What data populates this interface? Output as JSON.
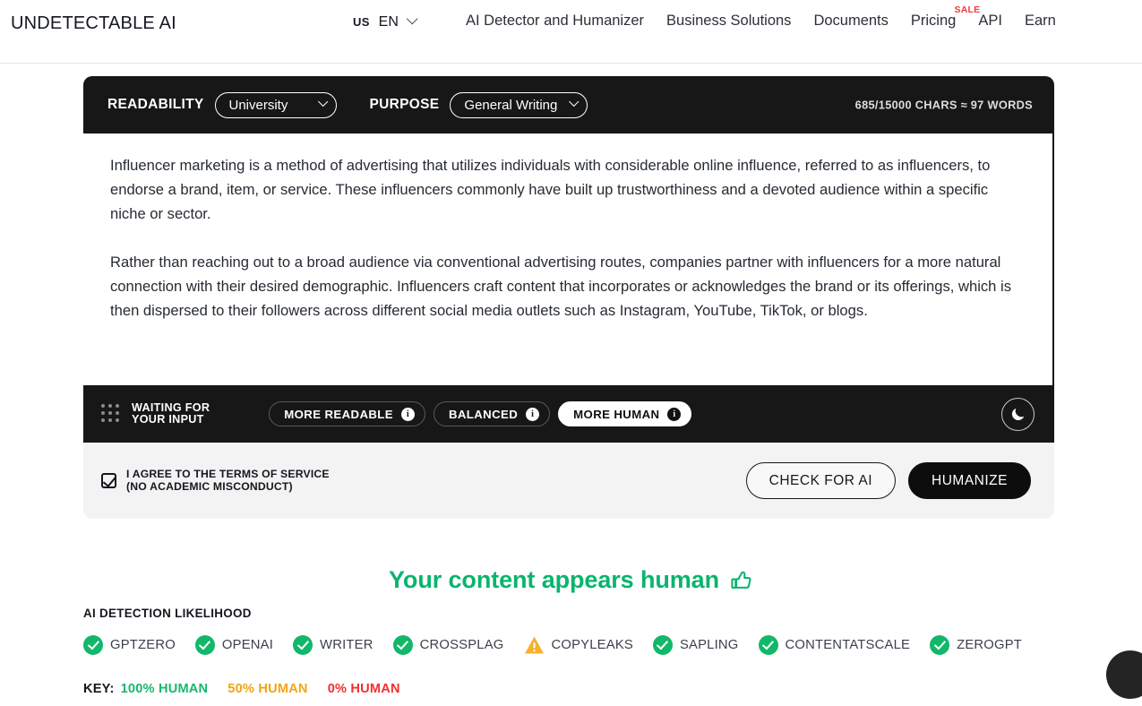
{
  "nav": {
    "brand": "UNDETECTABLE AI",
    "locale_country": "US",
    "locale_lang": "EN",
    "locale_chevron_icon": "chevron-down-icon",
    "links": [
      {
        "label": "AI Detector and Humanizer",
        "badge": ""
      },
      {
        "label": "Business Solutions",
        "badge": ""
      },
      {
        "label": "Documents",
        "badge": ""
      },
      {
        "label": "Pricing",
        "badge": "SALE"
      },
      {
        "label": "API",
        "badge": ""
      },
      {
        "label": "Earn",
        "badge": ""
      }
    ]
  },
  "editor": {
    "readability_label": "READABILITY",
    "readability_value": "University",
    "purpose_label": "PURPOSE",
    "purpose_value": "General Writing",
    "char_count": "685/15000 CHARS ≈ 97 WORDS",
    "paragraphs": [
      "Influencer marketing is a method of advertising that utilizes individuals with considerable online influence, referred to as influencers, to endorse a brand, item, or service. These influencers commonly have built up trustworthiness and a devoted audience within a specific niche or sector.",
      "Rather than reaching out to a broad audience via conventional advertising routes, companies partner with influencers for a more natural connection with their desired demographic. Influencers craft content that incorporates or acknowledges the brand or its offerings, which is then dispersed to their followers across different social media outlets such as Instagram, YouTube, TikTok, or blogs."
    ],
    "status": "WAITING FOR\nYOUR INPUT",
    "drag_icon": "dot-grid-icon",
    "modes": [
      {
        "label": "MORE READABLE",
        "active": false,
        "info_icon": "info-icon"
      },
      {
        "label": "BALANCED",
        "active": false,
        "info_icon": "info-icon"
      },
      {
        "label": "MORE HUMAN",
        "active": true,
        "info_icon": "info-icon"
      }
    ],
    "theme_toggle_icon": "moon-icon"
  },
  "footer": {
    "agree_text": "I AGREE TO THE TERMS OF SERVICE\n(NO ACADEMIC MISCONDUCT)",
    "agree_checked": true,
    "check_button": "CHECK FOR AI",
    "humanize_button": "HUMANIZE"
  },
  "results": {
    "verdict": "Your content appears human",
    "verdict_icon": "thumbs-up-icon",
    "verdict_color": "#09b46e",
    "section_label": "AI DETECTION LIKELIHOOD",
    "detectors": [
      {
        "name": "GPTZERO",
        "status": "ok",
        "icon": "check-circle-icon"
      },
      {
        "name": "OPENAI",
        "status": "ok",
        "icon": "check-circle-icon"
      },
      {
        "name": "WRITER",
        "status": "ok",
        "icon": "check-circle-icon"
      },
      {
        "name": "CROSSPLAG",
        "status": "ok",
        "icon": "check-circle-icon"
      },
      {
        "name": "COPYLEAKS",
        "status": "warn",
        "icon": "warning-triangle-icon"
      },
      {
        "name": "SAPLING",
        "status": "ok",
        "icon": "check-circle-icon"
      },
      {
        "name": "CONTENTATSCALE",
        "status": "ok",
        "icon": "check-circle-icon"
      },
      {
        "name": "ZEROGPT",
        "status": "ok",
        "icon": "check-circle-icon"
      }
    ],
    "key_label": "KEY:",
    "key_100": "100% HUMAN",
    "key_50": "50% HUMAN",
    "key_0": "0% HUMAN",
    "colors": {
      "ok": "#12b76a",
      "warn": "#f5b22d",
      "bad": "#f03030"
    }
  },
  "widget": {
    "icon": "chat-bubble-icon"
  }
}
